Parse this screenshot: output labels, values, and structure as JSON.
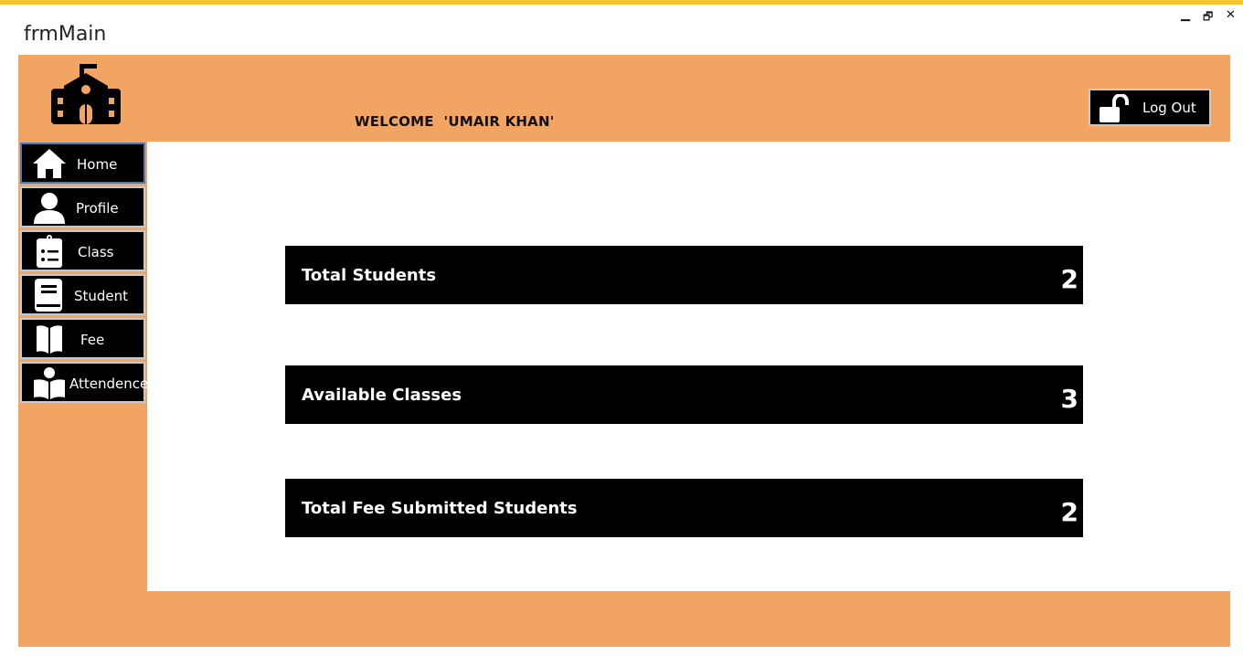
{
  "colors": {
    "accent_bar": "#f7c42c",
    "frame": "#f2a462",
    "card": "#000000",
    "active_border": "#3d7fc4"
  },
  "window": {
    "title": "frmMain",
    "minimize": "▁",
    "restore": "🗗",
    "close": "✕"
  },
  "header": {
    "logo_icon": "school-icon",
    "welcome": "WELCOME  'UMAIR KHAN'",
    "logout_label": "Log Out",
    "logout_icon": "unlocked-padlock-icon"
  },
  "sidebar": {
    "items": [
      {
        "label": "Home",
        "icon": "home-icon",
        "active": true
      },
      {
        "label": "Profile",
        "icon": "user-icon",
        "active": false
      },
      {
        "label": "Class",
        "icon": "clipboard-list-icon",
        "active": false
      },
      {
        "label": "Student",
        "icon": "book-icon",
        "active": false
      },
      {
        "label": "Fee",
        "icon": "open-book-icon",
        "active": false
      },
      {
        "label": "Attendence",
        "icon": "reader-icon",
        "active": false
      }
    ]
  },
  "dashboard": {
    "cards": [
      {
        "label": "Total Students",
        "value": "2"
      },
      {
        "label": "Available Classes",
        "value": "3"
      },
      {
        "label": "Total Fee Submitted Students",
        "value": "2"
      }
    ]
  }
}
